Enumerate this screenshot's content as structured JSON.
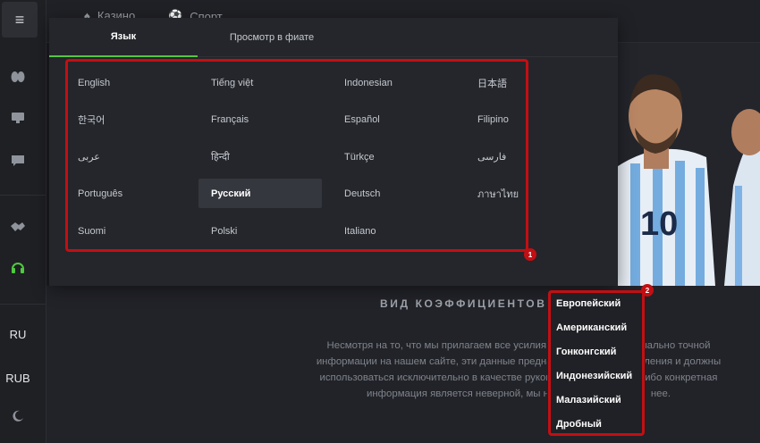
{
  "sidebar": {
    "menu_icon": "menu-icon",
    "icons": [
      "kidneys-icon",
      "monitor-icon",
      "chat-icon",
      "handshake-icon",
      "headset-icon"
    ],
    "lang_code": "RU",
    "currency": "RUB",
    "theme_icon": "moon-icon",
    "accent_color": "#4fc93f"
  },
  "topnav": {
    "items": [
      "Казино",
      "Спорт"
    ]
  },
  "language_panel": {
    "tabs": [
      {
        "label": "Язык",
        "active": true
      },
      {
        "label": "Просмотр в фиате",
        "active": false
      }
    ],
    "languages": [
      "English",
      "Tiếng việt",
      "Indonesian",
      "日本語",
      "한국어",
      "Français",
      "Español",
      "Filipino",
      "عربى",
      "हिन्दी",
      "Türkçe",
      "فارسی",
      "Português",
      "Русский",
      "Deutsch",
      "ภาษาไทย",
      "Suomi",
      "Polski",
      "Italiano"
    ],
    "selected": "Русский",
    "accent_color": "#58c542"
  },
  "odds": {
    "heading": "ВИД КОЭФФИЦИЕНТОВ",
    "description_lines": [
      "Несмотря на то, что мы прилагаем все усилия д                              мально точной",
      "информации на нашем сайте, эти данные предназ                             вления и должны",
      "использоваться исключительно в качестве руковод                           либо конкретная",
      "информация является неверной, мы не                                  нее."
    ],
    "options": [
      "Европейский",
      "Американский",
      "Гонконгский",
      "Индонезийский",
      "Малазийский",
      "Дробный"
    ]
  },
  "annotations": {
    "badge_1": "1",
    "badge_2": "2",
    "color": "#c30f13"
  }
}
